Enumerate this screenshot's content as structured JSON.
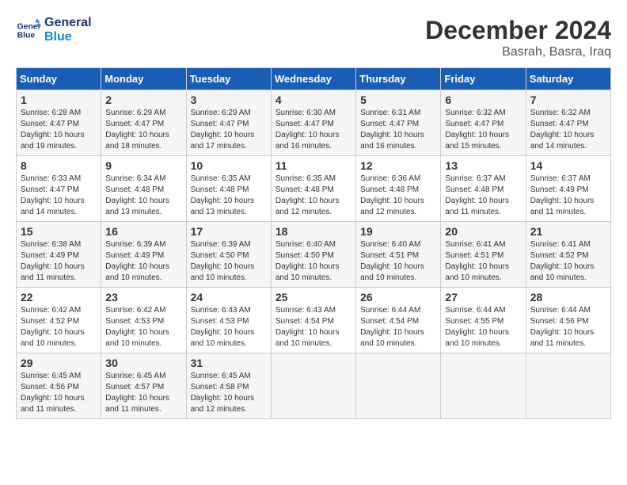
{
  "header": {
    "logo_line1": "General",
    "logo_line2": "Blue",
    "month": "December 2024",
    "location": "Basrah, Basra, Iraq"
  },
  "days_of_week": [
    "Sunday",
    "Monday",
    "Tuesday",
    "Wednesday",
    "Thursday",
    "Friday",
    "Saturday"
  ],
  "weeks": [
    [
      {
        "day": "1",
        "sunrise": "6:28 AM",
        "sunset": "4:47 PM",
        "daylight": "10 hours and 19 minutes."
      },
      {
        "day": "2",
        "sunrise": "6:29 AM",
        "sunset": "4:47 PM",
        "daylight": "10 hours and 18 minutes."
      },
      {
        "day": "3",
        "sunrise": "6:29 AM",
        "sunset": "4:47 PM",
        "daylight": "10 hours and 17 minutes."
      },
      {
        "day": "4",
        "sunrise": "6:30 AM",
        "sunset": "4:47 PM",
        "daylight": "10 hours and 16 minutes."
      },
      {
        "day": "5",
        "sunrise": "6:31 AM",
        "sunset": "4:47 PM",
        "daylight": "10 hours and 16 minutes."
      },
      {
        "day": "6",
        "sunrise": "6:32 AM",
        "sunset": "4:47 PM",
        "daylight": "10 hours and 15 minutes."
      },
      {
        "day": "7",
        "sunrise": "6:32 AM",
        "sunset": "4:47 PM",
        "daylight": "10 hours and 14 minutes."
      }
    ],
    [
      {
        "day": "8",
        "sunrise": "6:33 AM",
        "sunset": "4:47 PM",
        "daylight": "10 hours and 14 minutes."
      },
      {
        "day": "9",
        "sunrise": "6:34 AM",
        "sunset": "4:48 PM",
        "daylight": "10 hours and 13 minutes."
      },
      {
        "day": "10",
        "sunrise": "6:35 AM",
        "sunset": "4:48 PM",
        "daylight": "10 hours and 13 minutes."
      },
      {
        "day": "11",
        "sunrise": "6:35 AM",
        "sunset": "4:48 PM",
        "daylight": "10 hours and 12 minutes."
      },
      {
        "day": "12",
        "sunrise": "6:36 AM",
        "sunset": "4:48 PM",
        "daylight": "10 hours and 12 minutes."
      },
      {
        "day": "13",
        "sunrise": "6:37 AM",
        "sunset": "4:48 PM",
        "daylight": "10 hours and 11 minutes."
      },
      {
        "day": "14",
        "sunrise": "6:37 AM",
        "sunset": "4:49 PM",
        "daylight": "10 hours and 11 minutes."
      }
    ],
    [
      {
        "day": "15",
        "sunrise": "6:38 AM",
        "sunset": "4:49 PM",
        "daylight": "10 hours and 11 minutes."
      },
      {
        "day": "16",
        "sunrise": "6:39 AM",
        "sunset": "4:49 PM",
        "daylight": "10 hours and 10 minutes."
      },
      {
        "day": "17",
        "sunrise": "6:39 AM",
        "sunset": "4:50 PM",
        "daylight": "10 hours and 10 minutes."
      },
      {
        "day": "18",
        "sunrise": "6:40 AM",
        "sunset": "4:50 PM",
        "daylight": "10 hours and 10 minutes."
      },
      {
        "day": "19",
        "sunrise": "6:40 AM",
        "sunset": "4:51 PM",
        "daylight": "10 hours and 10 minutes."
      },
      {
        "day": "20",
        "sunrise": "6:41 AM",
        "sunset": "4:51 PM",
        "daylight": "10 hours and 10 minutes."
      },
      {
        "day": "21",
        "sunrise": "6:41 AM",
        "sunset": "4:52 PM",
        "daylight": "10 hours and 10 minutes."
      }
    ],
    [
      {
        "day": "22",
        "sunrise": "6:42 AM",
        "sunset": "4:52 PM",
        "daylight": "10 hours and 10 minutes."
      },
      {
        "day": "23",
        "sunrise": "6:42 AM",
        "sunset": "4:53 PM",
        "daylight": "10 hours and 10 minutes."
      },
      {
        "day": "24",
        "sunrise": "6:43 AM",
        "sunset": "4:53 PM",
        "daylight": "10 hours and 10 minutes."
      },
      {
        "day": "25",
        "sunrise": "6:43 AM",
        "sunset": "4:54 PM",
        "daylight": "10 hours and 10 minutes."
      },
      {
        "day": "26",
        "sunrise": "6:44 AM",
        "sunset": "4:54 PM",
        "daylight": "10 hours and 10 minutes."
      },
      {
        "day": "27",
        "sunrise": "6:44 AM",
        "sunset": "4:55 PM",
        "daylight": "10 hours and 10 minutes."
      },
      {
        "day": "28",
        "sunrise": "6:44 AM",
        "sunset": "4:56 PM",
        "daylight": "10 hours and 11 minutes."
      }
    ],
    [
      {
        "day": "29",
        "sunrise": "6:45 AM",
        "sunset": "4:56 PM",
        "daylight": "10 hours and 11 minutes."
      },
      {
        "day": "30",
        "sunrise": "6:45 AM",
        "sunset": "4:57 PM",
        "daylight": "10 hours and 11 minutes."
      },
      {
        "day": "31",
        "sunrise": "6:45 AM",
        "sunset": "4:58 PM",
        "daylight": "10 hours and 12 minutes."
      },
      null,
      null,
      null,
      null
    ]
  ],
  "labels": {
    "sunrise_prefix": "Sunrise: ",
    "sunset_prefix": "Sunset: ",
    "daylight_prefix": "Daylight: "
  }
}
